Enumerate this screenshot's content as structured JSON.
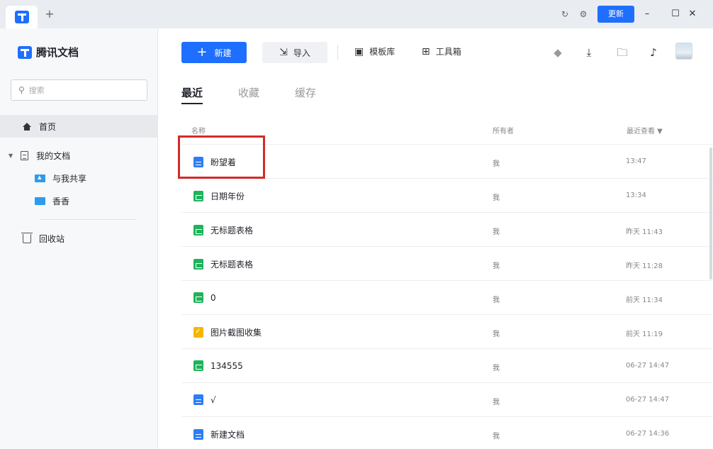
{
  "titlebar": {
    "add_tab": "+",
    "update_label": "更新",
    "minimize": "–",
    "maximize": "☐",
    "close": "✕"
  },
  "sidebar": {
    "brand": "腾讯文档",
    "search_placeholder": "搜索",
    "home": "首页",
    "my_docs": "我的文档",
    "shared": "与我共享",
    "folder": "香香",
    "trash": "回收站"
  },
  "toolbar": {
    "new_label": "新建",
    "import_label": "导入",
    "template_label": "模板库",
    "toolbox_label": "工具箱"
  },
  "tabs": [
    "最近",
    "收藏",
    "缓存"
  ],
  "table": {
    "headers": {
      "name": "名称",
      "owner": "所有者",
      "time": "最近查看 ▼"
    },
    "rows": [
      {
        "name": "盼望着",
        "type": "doc",
        "owner": "我",
        "time": "13:47"
      },
      {
        "name": "日期年份",
        "type": "sheet",
        "owner": "我",
        "time": "13:34"
      },
      {
        "name": "无标题表格",
        "type": "sheet",
        "owner": "我",
        "time": "昨天 11:43"
      },
      {
        "name": "无标题表格",
        "type": "sheet",
        "owner": "我",
        "time": "昨天 11:28"
      },
      {
        "name": "0",
        "type": "sheet",
        "owner": "我",
        "time": "前天 11:34"
      },
      {
        "name": "图片截图收集",
        "type": "collect",
        "owner": "我",
        "time": "前天 11:19"
      },
      {
        "name": "134555",
        "type": "sheet",
        "owner": "我",
        "time": "06-27 14:47"
      },
      {
        "name": "√",
        "type": "doc",
        "owner": "我",
        "time": "06-27 14:47"
      },
      {
        "name": "新建文档",
        "type": "doc",
        "owner": "我",
        "time": "06-27 14:36"
      }
    ]
  },
  "colors": {
    "accent": "#1e6fff",
    "highlight": "#d42a2a",
    "sheet": "#1fb35b",
    "doc": "#2e7cf6",
    "collect": "#f7b500"
  }
}
